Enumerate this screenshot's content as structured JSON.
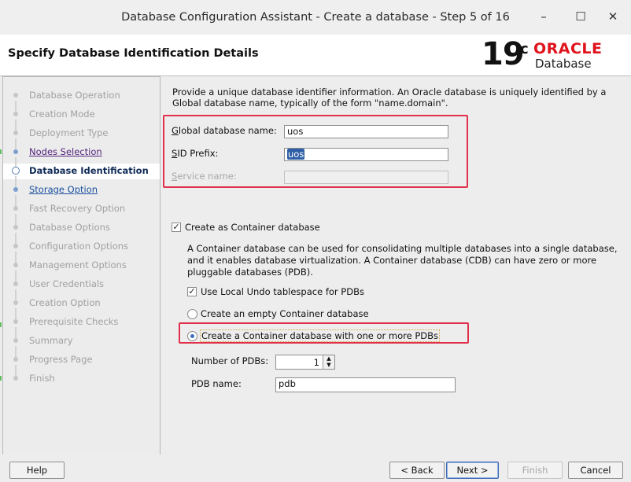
{
  "window": {
    "title": "Database Configuration Assistant - Create a database - Step 5 of 16",
    "minimize": "–",
    "maximize": "☐",
    "close": "✕"
  },
  "header": {
    "title": "Specify Database Identification Details",
    "brand_version": "19",
    "brand_version_suffix": "c",
    "brand_name": "ORACLE",
    "brand_product": "Database"
  },
  "steps": [
    {
      "label": "Database Operation",
      "state": "done"
    },
    {
      "label": "Creation Mode",
      "state": "done"
    },
    {
      "label": "Deployment Type",
      "state": "done"
    },
    {
      "label": "Nodes Selection",
      "state": "visited-link"
    },
    {
      "label": "Database Identification",
      "state": "current"
    },
    {
      "label": "Storage Option",
      "state": "link"
    },
    {
      "label": "Fast Recovery Option",
      "state": "pending"
    },
    {
      "label": "Database Options",
      "state": "pending"
    },
    {
      "label": "Configuration Options",
      "state": "pending"
    },
    {
      "label": "Management Options",
      "state": "pending"
    },
    {
      "label": "User Credentials",
      "state": "pending"
    },
    {
      "label": "Creation Option",
      "state": "pending"
    },
    {
      "label": "Prerequisite Checks",
      "state": "pending"
    },
    {
      "label": "Summary",
      "state": "pending"
    },
    {
      "label": "Progress Page",
      "state": "pending"
    },
    {
      "label": "Finish",
      "state": "pending"
    }
  ],
  "content": {
    "description": "Provide a unique database identifier information. An Oracle database is uniquely identified by a Global database name, typically of the form \"name.domain\".",
    "global_db_label_key": "G",
    "global_db_label_rest": "lobal database name:",
    "global_db_value": "uos",
    "sid_label_key": "S",
    "sid_label_rest": "ID Prefix:",
    "sid_value": "uos",
    "service_label_key": "S",
    "service_label_rest": "ervice name:",
    "service_value": "",
    "container_checkbox_label": "Create as Container database",
    "container_checked": true,
    "container_desc": "A Container database can be used for consolidating multiple databases into a single database, and it enables database virtualization. A Container database (CDB) can have zero or more pluggable databases (PDB).",
    "local_undo_label": "Use Local Undo tablespace for PDBs",
    "local_undo_checked": true,
    "empty_cdb_label": "Create an empty Container database",
    "with_pdbs_label": "Create a Container database with one or more PDBs",
    "num_pdbs_label": "Number of PDBs:",
    "num_pdbs_value": "1",
    "pdb_name_label": "PDB name:",
    "pdb_name_value": "pdb"
  },
  "buttons": {
    "help": "Help",
    "back": "< Back",
    "next": "Next >",
    "finish": "Finish",
    "cancel": "Cancel"
  },
  "colors": {
    "highlight_box": "#e0304c",
    "oracle_red": "#e0131d",
    "link": "#1a4f9e",
    "visited_link": "#53237c",
    "current_step": "#102b57"
  }
}
